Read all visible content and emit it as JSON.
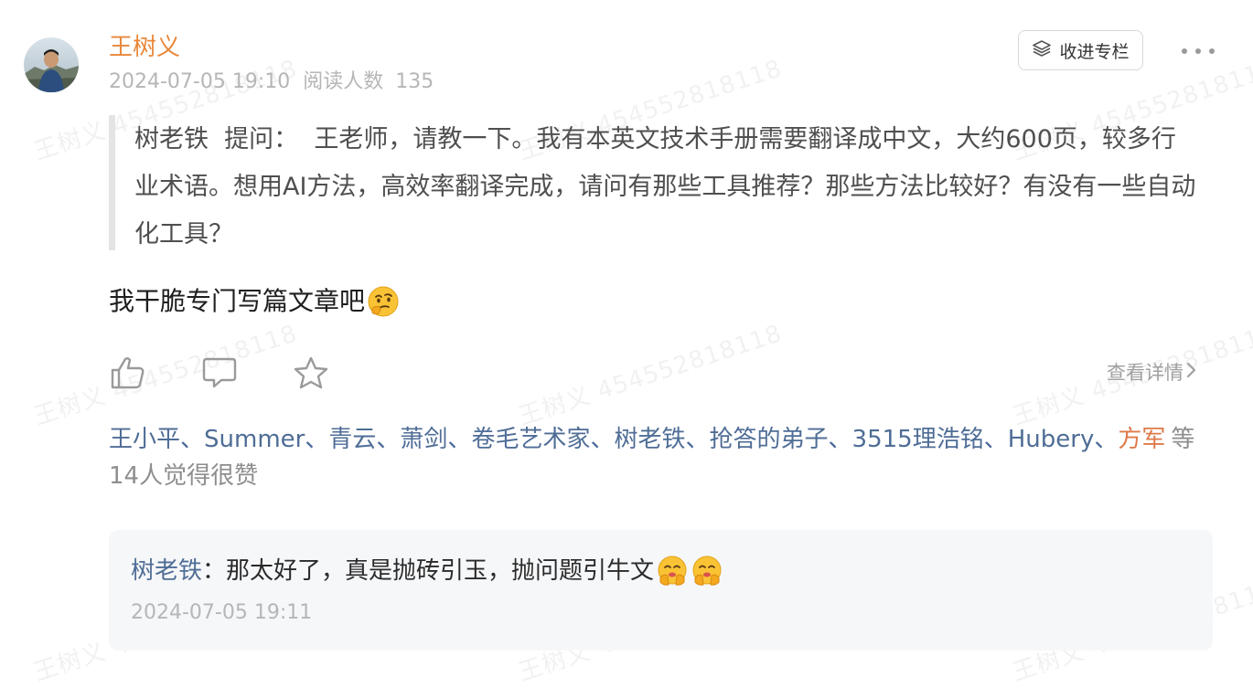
{
  "watermark": {
    "text": "王树义 454552818118"
  },
  "post": {
    "author": "王树义",
    "date": "2024-07-05 19:10",
    "read_label": "阅读人数",
    "read_count": "135",
    "collect_label": "收进专栏",
    "quote": {
      "user": "树老铁",
      "ask_label": "提问：",
      "text": "王老师，请教一下。我有本英文技术手册需要翻译成中文，大约600页，较多行业术语。想用AI方法，高效率翻译完成，请问有那些工具推荐？那些方法比较好？有没有一些自动化工具？"
    },
    "body": "我干脆专门写篇文章吧",
    "detail_label": "查看详情"
  },
  "likes": {
    "names": [
      "王小平",
      "Summer",
      "青云",
      "萧剑",
      "卷毛艺术家",
      "树老铁",
      "抢答的弟子",
      "3515理浩铭",
      "Hubery"
    ],
    "last_name": "方军",
    "summary": "等14人觉得很赞",
    "separator": "、"
  },
  "comment": {
    "user": "树老铁",
    "colon": "：",
    "text": "那太好了，真是抛砖引玉，抛问题引牛文",
    "time": "2024-07-05 19:11"
  },
  "colors": {
    "author": "#e8883b",
    "link_blue": "#4f6d96",
    "link_orange": "#de7a4a",
    "muted": "#b6b6b6"
  },
  "icons": [
    "avatar",
    "collect-stack-icon",
    "more-dots-icon",
    "thinking-emoji",
    "like-thumb-icon",
    "comment-bubble-icon",
    "star-icon",
    "chevron-right-icon",
    "shushing-emoji"
  ]
}
